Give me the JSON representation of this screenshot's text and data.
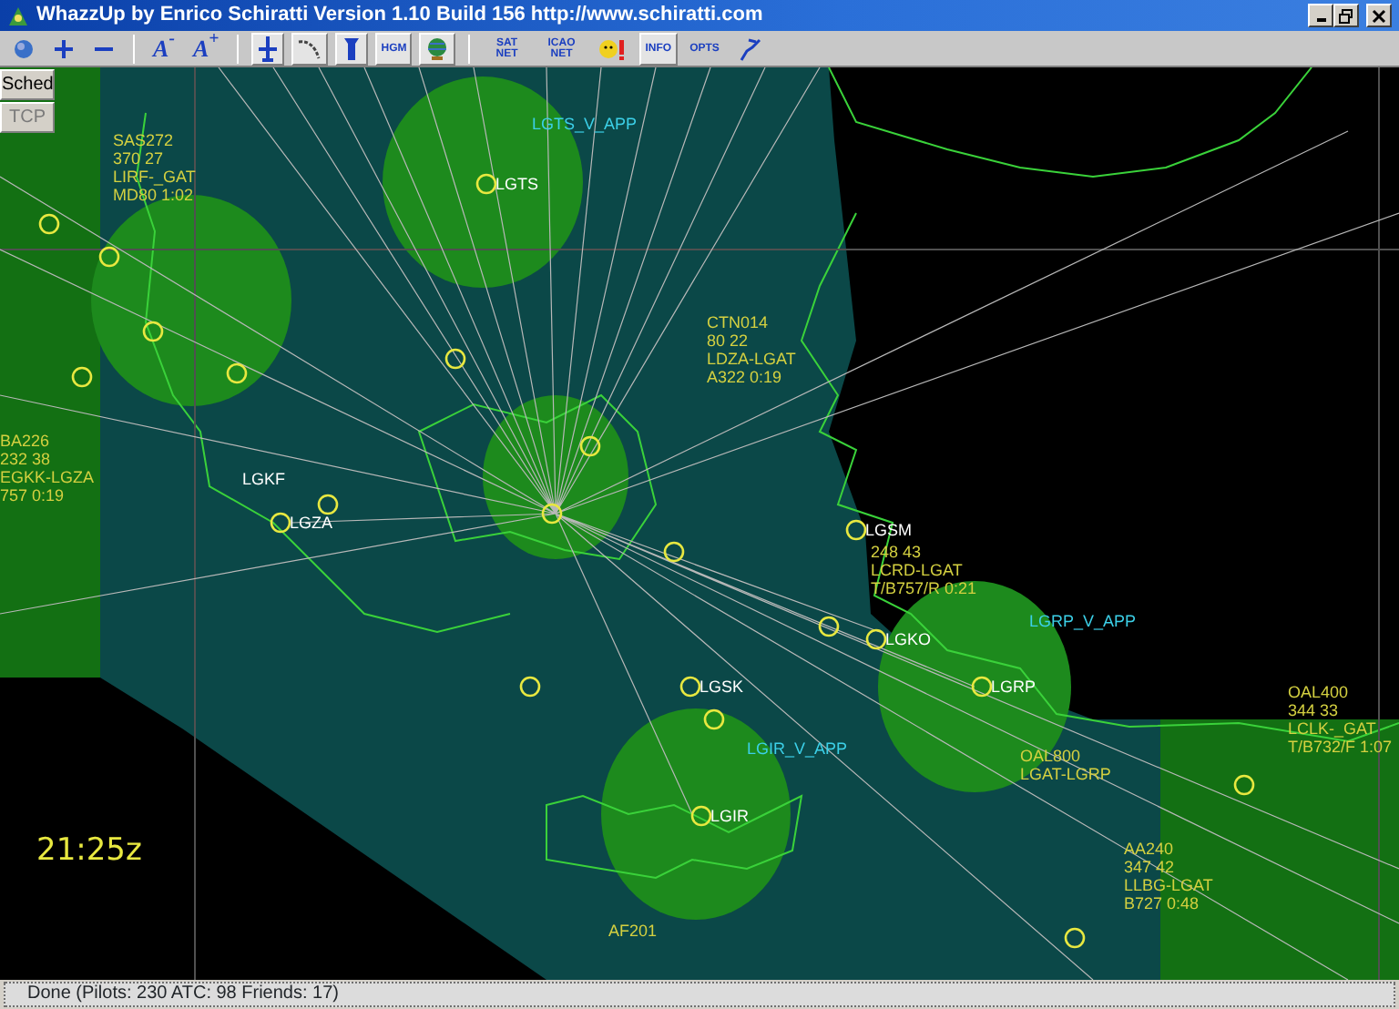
{
  "window": {
    "title": "WhazzUp by Enrico Schiratti Version 1.10 Build 156 http://www.schiratti.com"
  },
  "toolbar": [
    {
      "kind": "icon",
      "pressed": false
    },
    {
      "kind": "icon",
      "pressed": false
    },
    {
      "kind": "icon",
      "pressed": false
    },
    {
      "kind": "font",
      "label": "A$^{-}$",
      "pressed": false
    },
    {
      "kind": "font",
      "label": "A$^{+}$",
      "pressed": false
    },
    {
      "kind": "icon",
      "pressed": true
    },
    {
      "kind": "icon",
      "pressed": true
    },
    {
      "kind": "icon",
      "pressed": true
    },
    {
      "kind": "text",
      "label": "HGM",
      "pressed": true
    },
    {
      "kind": "icon",
      "pressed": true
    },
    {
      "kind": "text",
      "label": "SAT NET",
      "pressed": false
    },
    {
      "kind": "text",
      "label": "ICAO NET",
      "pressed": false
    },
    {
      "kind": "icon",
      "pressed": false
    },
    {
      "kind": "text",
      "label": "INFO",
      "pressed": true
    },
    {
      "kind": "text",
      "label": "OPTS",
      "pressed": false
    },
    {
      "kind": "icon",
      "pressed": false
    }
  ],
  "side_buttons": [
    {
      "label": "Sched",
      "disabled": false
    },
    {
      "label": "TCP",
      "disabled": true
    }
  ],
  "map": {
    "airports": [
      {
        "code": "LGKF"
      },
      {
        "code": "LGZA"
      },
      {
        "code": "LGTS"
      },
      {
        "code": "LGSM"
      },
      {
        "code": "LGKO"
      },
      {
        "code": "LGRP"
      },
      {
        "code": "LGIR"
      },
      {
        "code": "LGSK"
      }
    ],
    "atc": [
      {
        "label": "LGTS_V_APP"
      },
      {
        "label": "LGRP_V_APP"
      },
      {
        "label": "LGIR_V_APP"
      }
    ],
    "flights": [
      {
        "lines": [
          "BA226",
          "232 38",
          "EGKK-LGZA",
          "757 0:19"
        ]
      },
      {
        "lines": [
          "SAS272",
          "370 27",
          "LIRF-_GAT",
          "MD80 1:02"
        ]
      },
      {
        "lines": [
          "CTN014",
          "80 22",
          "LDZA-LGAT",
          "A322 0:19"
        ]
      },
      {
        "lines": [
          "OAL400",
          "344 33",
          "LCLK-_GAT",
          "T/B732/F 1:07"
        ]
      },
      {
        "lines": [
          "AA240",
          "347 42",
          "LLBG-LGAT",
          "B727 0:48"
        ]
      },
      {
        "lines": [
          "OAL800",
          "LGAT-LGRP"
        ]
      },
      {
        "lines": [
          "248 43",
          "LCRD-LGAT",
          "T/B757/R 0:21"
        ]
      },
      {
        "lines": [
          "AF201"
        ]
      }
    ],
    "clock": "21:25z"
  },
  "status_bar": "Done (Pilots: 230 ATC: 98 Friends: 17)"
}
